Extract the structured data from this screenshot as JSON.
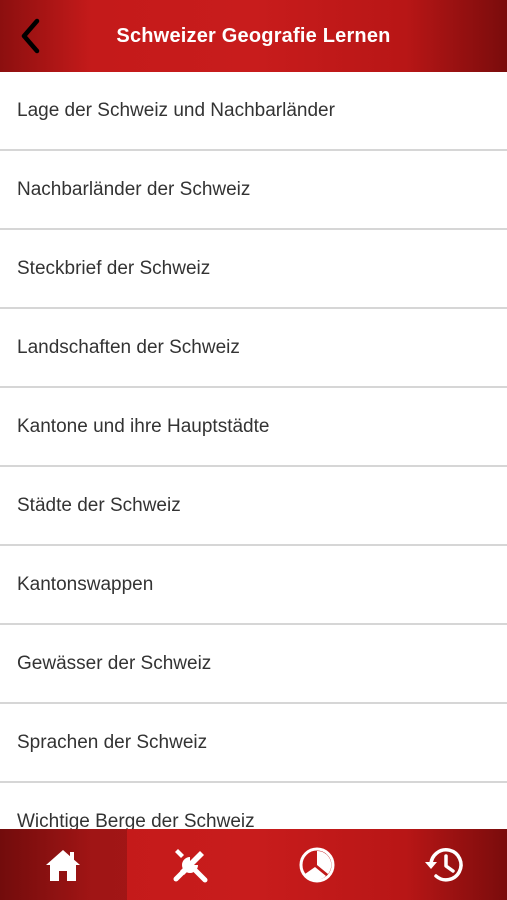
{
  "header": {
    "title": "Schweizer Geografie Lernen",
    "back_icon": "chevron-left-icon"
  },
  "topics": [
    "Lage der Schweiz und Nachbarländer",
    "Nachbarländer der Schweiz",
    "Steckbrief der Schweiz",
    "Landschaften der Schweiz",
    "Kantone und ihre Hauptstädte",
    "Städte der Schweiz",
    "Kantonswappen",
    "Gewässer der Schweiz",
    "Sprachen der Schweiz",
    "Wichtige Berge der Schweiz"
  ],
  "tabbar": {
    "tabs": [
      {
        "icon": "home-icon",
        "active": true
      },
      {
        "icon": "tools-icon",
        "active": false
      },
      {
        "icon": "pie-chart-icon",
        "active": false
      },
      {
        "icon": "history-icon",
        "active": false
      }
    ]
  },
  "colors": {
    "brand_red": "#c41a1a",
    "dark_red": "#7a0c0c",
    "text": "#333333",
    "divider": "#d6d6d6"
  }
}
